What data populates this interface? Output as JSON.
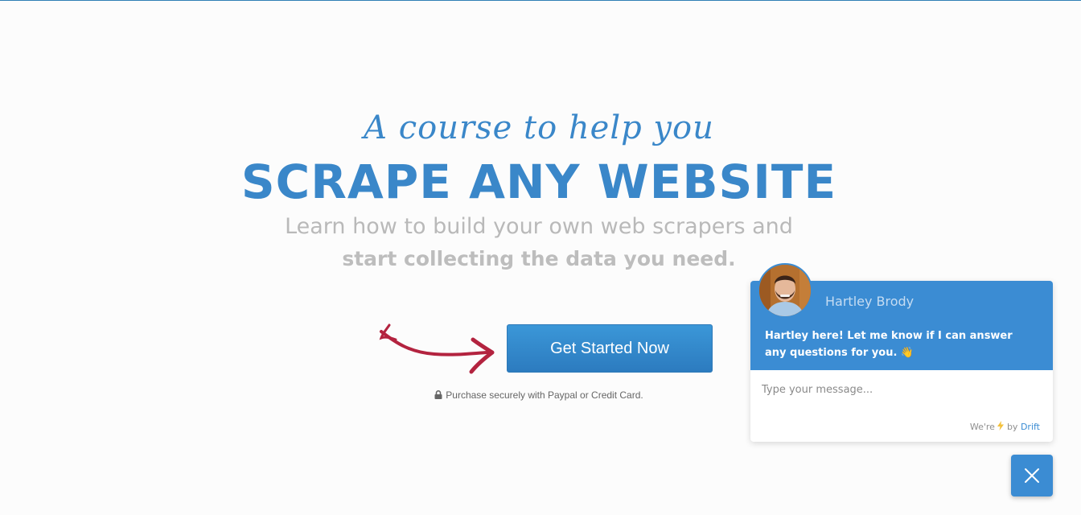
{
  "hero": {
    "tagline": "A course to help you",
    "headline": "SCRAPE ANY WEBSITE",
    "subtitle_line1": "Learn how to build your own web scrapers and",
    "subtitle_line2": "start collecting the data you need.",
    "cta_label": "Get Started Now",
    "secure_note": "Purchase securely with Paypal or Credit Card.",
    "accent_color": "#3a87c9",
    "arrow_color": "#b3233f"
  },
  "chat_widget": {
    "agent_name": "Hartley Brody",
    "message": "Hartley here! Let me know if I can answer any questions for you. 👋",
    "input_placeholder": "Type your message...",
    "credit_prefix": "We're",
    "credit_icon": "lightning-bolt-icon",
    "credit_by": "by",
    "credit_brand": "Drift",
    "header_color": "#3b8cd3",
    "close_icon": "close-icon"
  }
}
